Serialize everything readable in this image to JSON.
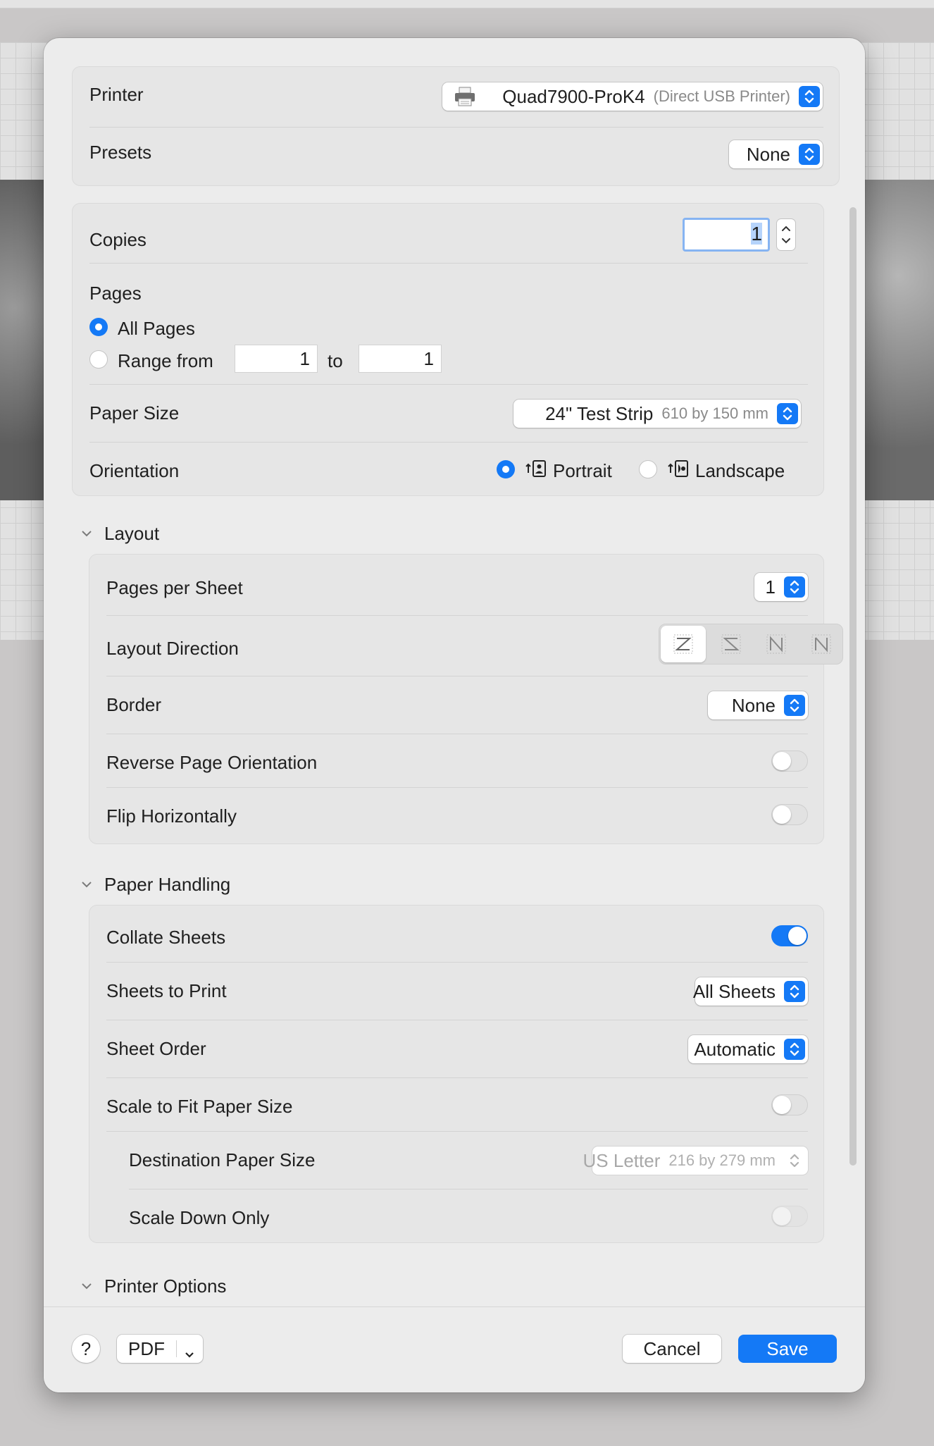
{
  "printer": {
    "label": "Printer",
    "name": "Quad7900-ProK4",
    "type": "(Direct USB Printer)",
    "icon": "printer-icon"
  },
  "presets": {
    "label": "Presets",
    "value": "None"
  },
  "copies": {
    "label": "Copies",
    "value": "1"
  },
  "pages": {
    "label": "Pages",
    "all_label": "All Pages",
    "range_label": "Range from",
    "range_from": "1",
    "to_label": "to",
    "range_to": "1",
    "selected": "all"
  },
  "paper_size": {
    "label": "Paper Size",
    "value": "24\" Test Strip",
    "dimensions": "610 by 150 mm"
  },
  "orientation": {
    "label": "Orientation",
    "portrait_label": "Portrait",
    "landscape_label": "Landscape",
    "selected": "portrait"
  },
  "layout": {
    "header": "Layout",
    "pages_per_sheet_label": "Pages per Sheet",
    "pages_per_sheet_value": "1",
    "layout_direction_label": "Layout Direction",
    "border_label": "Border",
    "border_value": "None",
    "reverse_label": "Reverse Page Orientation",
    "reverse_on": false,
    "flip_label": "Flip Horizontally",
    "flip_on": false
  },
  "paper_handling": {
    "header": "Paper Handling",
    "collate_label": "Collate Sheets",
    "collate_on": true,
    "sheets_to_print_label": "Sheets to Print",
    "sheets_to_print_value": "All Sheets",
    "sheet_order_label": "Sheet Order",
    "sheet_order_value": "Automatic",
    "scale_label": "Scale to Fit Paper Size",
    "scale_on": false,
    "dest_label": "Destination Paper Size",
    "dest_value": "US Letter",
    "dest_dimensions": "216 by 279 mm",
    "scale_down_label": "Scale Down Only",
    "scale_down_on": false
  },
  "printer_options": {
    "header": "Printer Options"
  },
  "footer": {
    "help_label": "?",
    "pdf_label": "PDF",
    "cancel_label": "Cancel",
    "save_label": "Save"
  },
  "colors": {
    "accent": "#1479f6",
    "dialog_bg": "#ececec"
  }
}
